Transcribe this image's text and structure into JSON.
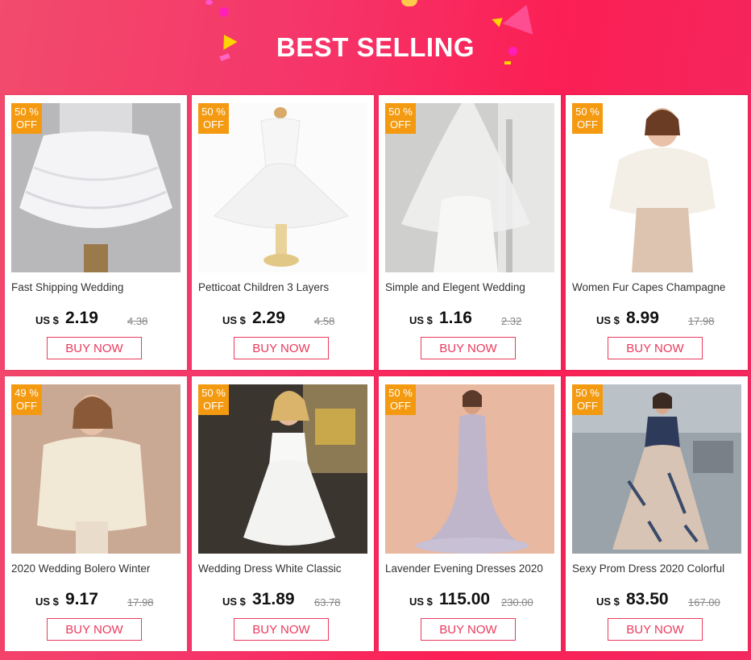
{
  "banner": {
    "title": "BEST SELLING"
  },
  "currency": "US $",
  "button_label": "BUY NOW",
  "products": [
    {
      "title": "Fast Shipping Wedding",
      "discount_pct": "50 %",
      "discount_off": "OFF",
      "price": "2.19",
      "old_price": "4.38"
    },
    {
      "title": "Petticoat Children 3 Layers",
      "discount_pct": "50 %",
      "discount_off": "OFF",
      "price": "2.29",
      "old_price": "4.58"
    },
    {
      "title": "Simple and Elegent Wedding",
      "discount_pct": "50 %",
      "discount_off": "OFF",
      "price": "1.16",
      "old_price": "2.32"
    },
    {
      "title": "Women Fur Capes Champagne",
      "discount_pct": "50 %",
      "discount_off": "OFF",
      "price": "8.99",
      "old_price": "17.98"
    },
    {
      "title": "2020 Wedding Bolero Winter",
      "discount_pct": "49 %",
      "discount_off": "OFF",
      "price": "9.17",
      "old_price": "17.98"
    },
    {
      "title": "Wedding Dress White Classic",
      "discount_pct": "50 %",
      "discount_off": "OFF",
      "price": "31.89",
      "old_price": "63.78"
    },
    {
      "title": "Lavender Evening Dresses 2020",
      "discount_pct": "50 %",
      "discount_off": "OFF",
      "price": "115.00",
      "old_price": "230.00"
    },
    {
      "title": "Sexy Prom Dress 2020 Colorful",
      "discount_pct": "50 %",
      "discount_off": "OFF",
      "price": "83.50",
      "old_price": "167.00"
    }
  ],
  "colors": {
    "accent": "#ea3a5c",
    "badge": "#f49a10",
    "banner_bg": "#f5366a"
  }
}
